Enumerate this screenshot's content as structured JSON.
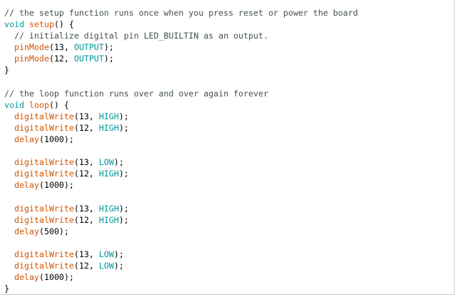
{
  "editor": {
    "lines": [
      [
        {
          "t": "// the setup function runs once when you press reset or power the board",
          "c": "comment"
        }
      ],
      [
        {
          "t": "void",
          "c": "kw-type"
        },
        {
          "t": " ",
          "c": "plain"
        },
        {
          "t": "setup",
          "c": "kw-func"
        },
        {
          "t": "() {",
          "c": "plain"
        }
      ],
      [
        {
          "t": "  // initialize digital pin LED_BUILTIN as an output.",
          "c": "comment"
        }
      ],
      [
        {
          "t": "  ",
          "c": "plain"
        },
        {
          "t": "pinMode",
          "c": "kw-func"
        },
        {
          "t": "(13, ",
          "c": "plain"
        },
        {
          "t": "OUTPUT",
          "c": "kw-const"
        },
        {
          "t": ");",
          "c": "plain"
        }
      ],
      [
        {
          "t": "  ",
          "c": "plain"
        },
        {
          "t": "pinMode",
          "c": "kw-func"
        },
        {
          "t": "(12, ",
          "c": "plain"
        },
        {
          "t": "OUTPUT",
          "c": "kw-const"
        },
        {
          "t": ");",
          "c": "plain"
        }
      ],
      [
        {
          "t": "}",
          "c": "plain"
        }
      ],
      [],
      [
        {
          "t": "// the loop function runs over and over again forever",
          "c": "comment"
        }
      ],
      [
        {
          "t": "void",
          "c": "kw-type"
        },
        {
          "t": " ",
          "c": "plain"
        },
        {
          "t": "loop",
          "c": "kw-func"
        },
        {
          "t": "() {",
          "c": "plain"
        }
      ],
      [
        {
          "t": "  ",
          "c": "plain"
        },
        {
          "t": "digitalWrite",
          "c": "kw-func"
        },
        {
          "t": "(13, ",
          "c": "plain"
        },
        {
          "t": "HIGH",
          "c": "kw-const"
        },
        {
          "t": ");",
          "c": "plain"
        }
      ],
      [
        {
          "t": "  ",
          "c": "plain"
        },
        {
          "t": "digitalWrite",
          "c": "kw-func"
        },
        {
          "t": "(12, ",
          "c": "plain"
        },
        {
          "t": "HIGH",
          "c": "kw-const"
        },
        {
          "t": ");",
          "c": "plain"
        }
      ],
      [
        {
          "t": "  ",
          "c": "plain"
        },
        {
          "t": "delay",
          "c": "kw-func"
        },
        {
          "t": "(1000);",
          "c": "plain"
        }
      ],
      [],
      [
        {
          "t": "  ",
          "c": "plain"
        },
        {
          "t": "digitalWrite",
          "c": "kw-func"
        },
        {
          "t": "(13, ",
          "c": "plain"
        },
        {
          "t": "LOW",
          "c": "kw-const"
        },
        {
          "t": ");",
          "c": "plain"
        }
      ],
      [
        {
          "t": "  ",
          "c": "plain"
        },
        {
          "t": "digitalWrite",
          "c": "kw-func"
        },
        {
          "t": "(12, ",
          "c": "plain"
        },
        {
          "t": "HIGH",
          "c": "kw-const"
        },
        {
          "t": ");",
          "c": "plain"
        }
      ],
      [
        {
          "t": "  ",
          "c": "plain"
        },
        {
          "t": "delay",
          "c": "kw-func"
        },
        {
          "t": "(1000);",
          "c": "plain"
        }
      ],
      [],
      [
        {
          "t": "  ",
          "c": "plain"
        },
        {
          "t": "digitalWrite",
          "c": "kw-func"
        },
        {
          "t": "(13, ",
          "c": "plain"
        },
        {
          "t": "HIGH",
          "c": "kw-const"
        },
        {
          "t": ");",
          "c": "plain"
        }
      ],
      [
        {
          "t": "  ",
          "c": "plain"
        },
        {
          "t": "digitalWrite",
          "c": "kw-func"
        },
        {
          "t": "(12, ",
          "c": "plain"
        },
        {
          "t": "HIGH",
          "c": "kw-const"
        },
        {
          "t": ");",
          "c": "plain"
        }
      ],
      [
        {
          "t": "  ",
          "c": "plain"
        },
        {
          "t": "delay",
          "c": "kw-func"
        },
        {
          "t": "(500);",
          "c": "plain"
        }
      ],
      [],
      [
        {
          "t": "  ",
          "c": "plain"
        },
        {
          "t": "digitalWrite",
          "c": "kw-func"
        },
        {
          "t": "(13, ",
          "c": "plain"
        },
        {
          "t": "LOW",
          "c": "kw-const"
        },
        {
          "t": ");",
          "c": "plain"
        }
      ],
      [
        {
          "t": "  ",
          "c": "plain"
        },
        {
          "t": "digitalWrite",
          "c": "kw-func"
        },
        {
          "t": "(12, ",
          "c": "plain"
        },
        {
          "t": "LOW",
          "c": "kw-const"
        },
        {
          "t": ");",
          "c": "plain"
        }
      ],
      [
        {
          "t": "  ",
          "c": "plain"
        },
        {
          "t": "delay",
          "c": "kw-func"
        },
        {
          "t": "(1000);",
          "c": "plain"
        }
      ],
      [
        {
          "t": "}",
          "c": "plain"
        }
      ]
    ]
  },
  "colors": {
    "comment": "#434f54",
    "keyword_type": "#00979c",
    "function": "#d35400",
    "constant": "#00979c",
    "text": "#000000",
    "background": "#ffffff"
  }
}
